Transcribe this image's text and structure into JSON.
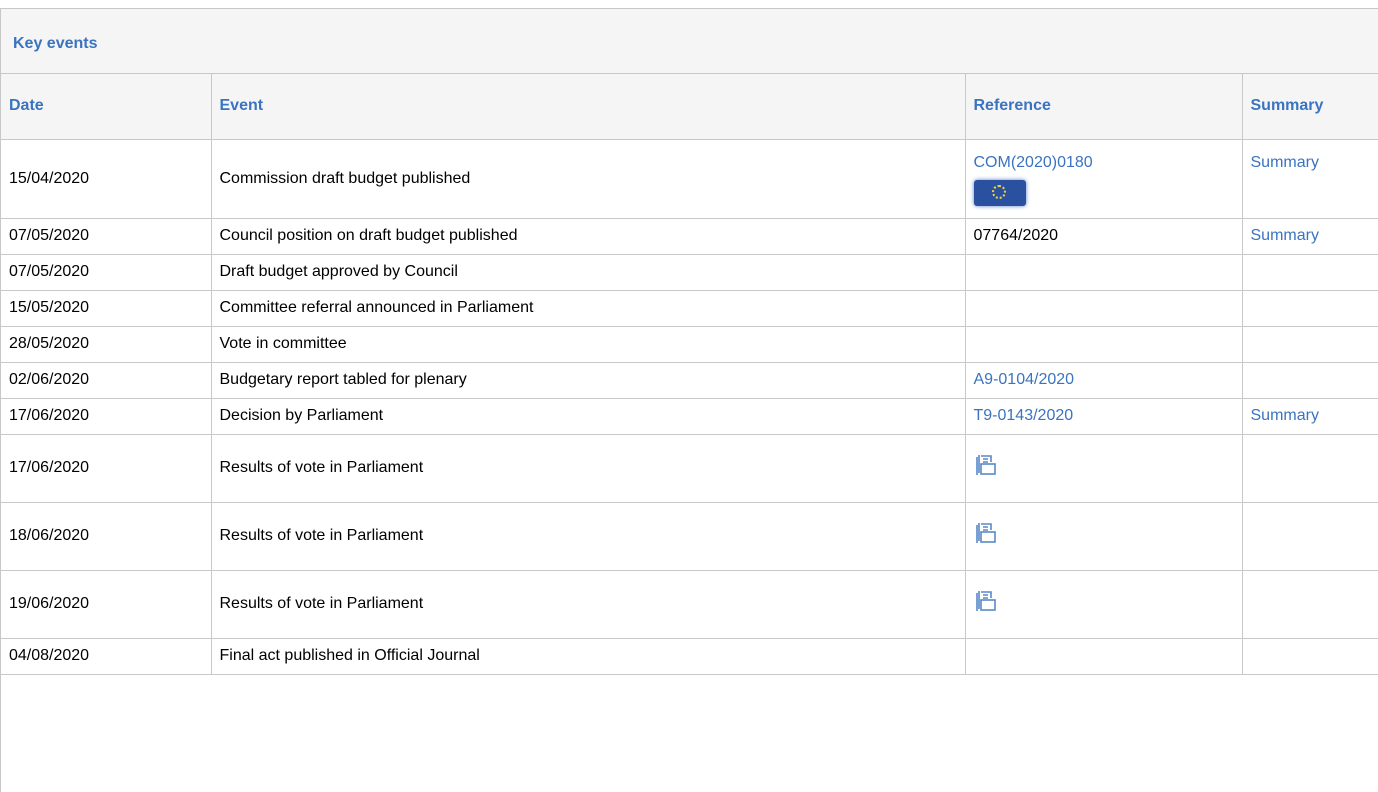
{
  "panel": {
    "title": "Key events"
  },
  "headers": {
    "date": "Date",
    "event": "Event",
    "reference": "Reference",
    "summary": "Summary"
  },
  "rows": [
    {
      "date": "15/04/2020",
      "event": "Commission draft budget published",
      "reference": "COM(2020)0180",
      "summary": "Summary"
    },
    {
      "date": "07/05/2020",
      "event": "Council position on draft budget published",
      "reference": "07764/2020",
      "summary": "Summary"
    },
    {
      "date": "07/05/2020",
      "event": "Draft budget approved by Council",
      "reference": "",
      "summary": ""
    },
    {
      "date": "15/05/2020",
      "event": "Committee referral announced in Parliament",
      "reference": "",
      "summary": ""
    },
    {
      "date": "28/05/2020",
      "event": "Vote in committee",
      "reference": "",
      "summary": ""
    },
    {
      "date": "02/06/2020",
      "event": "Budgetary report tabled for plenary",
      "reference": "A9-0104/2020",
      "summary": ""
    },
    {
      "date": "17/06/2020",
      "event": "Decision by Parliament",
      "reference": "T9-0143/2020",
      "summary": "Summary"
    },
    {
      "date": "17/06/2020",
      "event": "Results of vote in Parliament",
      "reference": "",
      "summary": ""
    },
    {
      "date": "18/06/2020",
      "event": "Results of vote in Parliament",
      "reference": "",
      "summary": ""
    },
    {
      "date": "19/06/2020",
      "event": "Results of vote in Parliament",
      "reference": "",
      "summary": ""
    },
    {
      "date": "04/08/2020",
      "event": "Final act published in Official Journal",
      "reference": "",
      "summary": ""
    }
  ],
  "icons": {
    "eu_flag": "eu-flag-icon",
    "vote": "vote-results-icon"
  },
  "colors": {
    "link": "#3a73c0",
    "header_bg": "#f5f5f5",
    "border": "#c8c8c8"
  }
}
